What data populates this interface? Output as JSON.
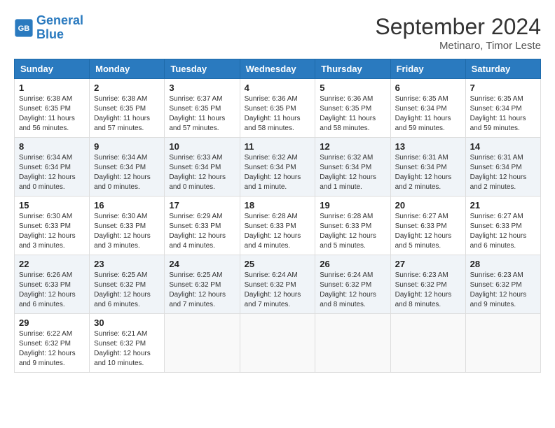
{
  "header": {
    "logo_line1": "General",
    "logo_line2": "Blue",
    "month_year": "September 2024",
    "location": "Metinaro, Timor Leste"
  },
  "weekdays": [
    "Sunday",
    "Monday",
    "Tuesday",
    "Wednesday",
    "Thursday",
    "Friday",
    "Saturday"
  ],
  "weeks": [
    [
      {
        "day": 1,
        "info": "Sunrise: 6:38 AM\nSunset: 6:35 PM\nDaylight: 11 hours\nand 56 minutes."
      },
      {
        "day": 2,
        "info": "Sunrise: 6:38 AM\nSunset: 6:35 PM\nDaylight: 11 hours\nand 57 minutes."
      },
      {
        "day": 3,
        "info": "Sunrise: 6:37 AM\nSunset: 6:35 PM\nDaylight: 11 hours\nand 57 minutes."
      },
      {
        "day": 4,
        "info": "Sunrise: 6:36 AM\nSunset: 6:35 PM\nDaylight: 11 hours\nand 58 minutes."
      },
      {
        "day": 5,
        "info": "Sunrise: 6:36 AM\nSunset: 6:35 PM\nDaylight: 11 hours\nand 58 minutes."
      },
      {
        "day": 6,
        "info": "Sunrise: 6:35 AM\nSunset: 6:34 PM\nDaylight: 11 hours\nand 59 minutes."
      },
      {
        "day": 7,
        "info": "Sunrise: 6:35 AM\nSunset: 6:34 PM\nDaylight: 11 hours\nand 59 minutes."
      }
    ],
    [
      {
        "day": 8,
        "info": "Sunrise: 6:34 AM\nSunset: 6:34 PM\nDaylight: 12 hours\nand 0 minutes."
      },
      {
        "day": 9,
        "info": "Sunrise: 6:34 AM\nSunset: 6:34 PM\nDaylight: 12 hours\nand 0 minutes."
      },
      {
        "day": 10,
        "info": "Sunrise: 6:33 AM\nSunset: 6:34 PM\nDaylight: 12 hours\nand 0 minutes."
      },
      {
        "day": 11,
        "info": "Sunrise: 6:32 AM\nSunset: 6:34 PM\nDaylight: 12 hours\nand 1 minute."
      },
      {
        "day": 12,
        "info": "Sunrise: 6:32 AM\nSunset: 6:34 PM\nDaylight: 12 hours\nand 1 minute."
      },
      {
        "day": 13,
        "info": "Sunrise: 6:31 AM\nSunset: 6:34 PM\nDaylight: 12 hours\nand 2 minutes."
      },
      {
        "day": 14,
        "info": "Sunrise: 6:31 AM\nSunset: 6:34 PM\nDaylight: 12 hours\nand 2 minutes."
      }
    ],
    [
      {
        "day": 15,
        "info": "Sunrise: 6:30 AM\nSunset: 6:33 PM\nDaylight: 12 hours\nand 3 minutes."
      },
      {
        "day": 16,
        "info": "Sunrise: 6:30 AM\nSunset: 6:33 PM\nDaylight: 12 hours\nand 3 minutes."
      },
      {
        "day": 17,
        "info": "Sunrise: 6:29 AM\nSunset: 6:33 PM\nDaylight: 12 hours\nand 4 minutes."
      },
      {
        "day": 18,
        "info": "Sunrise: 6:28 AM\nSunset: 6:33 PM\nDaylight: 12 hours\nand 4 minutes."
      },
      {
        "day": 19,
        "info": "Sunrise: 6:28 AM\nSunset: 6:33 PM\nDaylight: 12 hours\nand 5 minutes."
      },
      {
        "day": 20,
        "info": "Sunrise: 6:27 AM\nSunset: 6:33 PM\nDaylight: 12 hours\nand 5 minutes."
      },
      {
        "day": 21,
        "info": "Sunrise: 6:27 AM\nSunset: 6:33 PM\nDaylight: 12 hours\nand 6 minutes."
      }
    ],
    [
      {
        "day": 22,
        "info": "Sunrise: 6:26 AM\nSunset: 6:33 PM\nDaylight: 12 hours\nand 6 minutes."
      },
      {
        "day": 23,
        "info": "Sunrise: 6:25 AM\nSunset: 6:32 PM\nDaylight: 12 hours\nand 6 minutes."
      },
      {
        "day": 24,
        "info": "Sunrise: 6:25 AM\nSunset: 6:32 PM\nDaylight: 12 hours\nand 7 minutes."
      },
      {
        "day": 25,
        "info": "Sunrise: 6:24 AM\nSunset: 6:32 PM\nDaylight: 12 hours\nand 7 minutes."
      },
      {
        "day": 26,
        "info": "Sunrise: 6:24 AM\nSunset: 6:32 PM\nDaylight: 12 hours\nand 8 minutes."
      },
      {
        "day": 27,
        "info": "Sunrise: 6:23 AM\nSunset: 6:32 PM\nDaylight: 12 hours\nand 8 minutes."
      },
      {
        "day": 28,
        "info": "Sunrise: 6:23 AM\nSunset: 6:32 PM\nDaylight: 12 hours\nand 9 minutes."
      }
    ],
    [
      {
        "day": 29,
        "info": "Sunrise: 6:22 AM\nSunset: 6:32 PM\nDaylight: 12 hours\nand 9 minutes."
      },
      {
        "day": 30,
        "info": "Sunrise: 6:21 AM\nSunset: 6:32 PM\nDaylight: 12 hours\nand 10 minutes."
      },
      null,
      null,
      null,
      null,
      null
    ]
  ]
}
